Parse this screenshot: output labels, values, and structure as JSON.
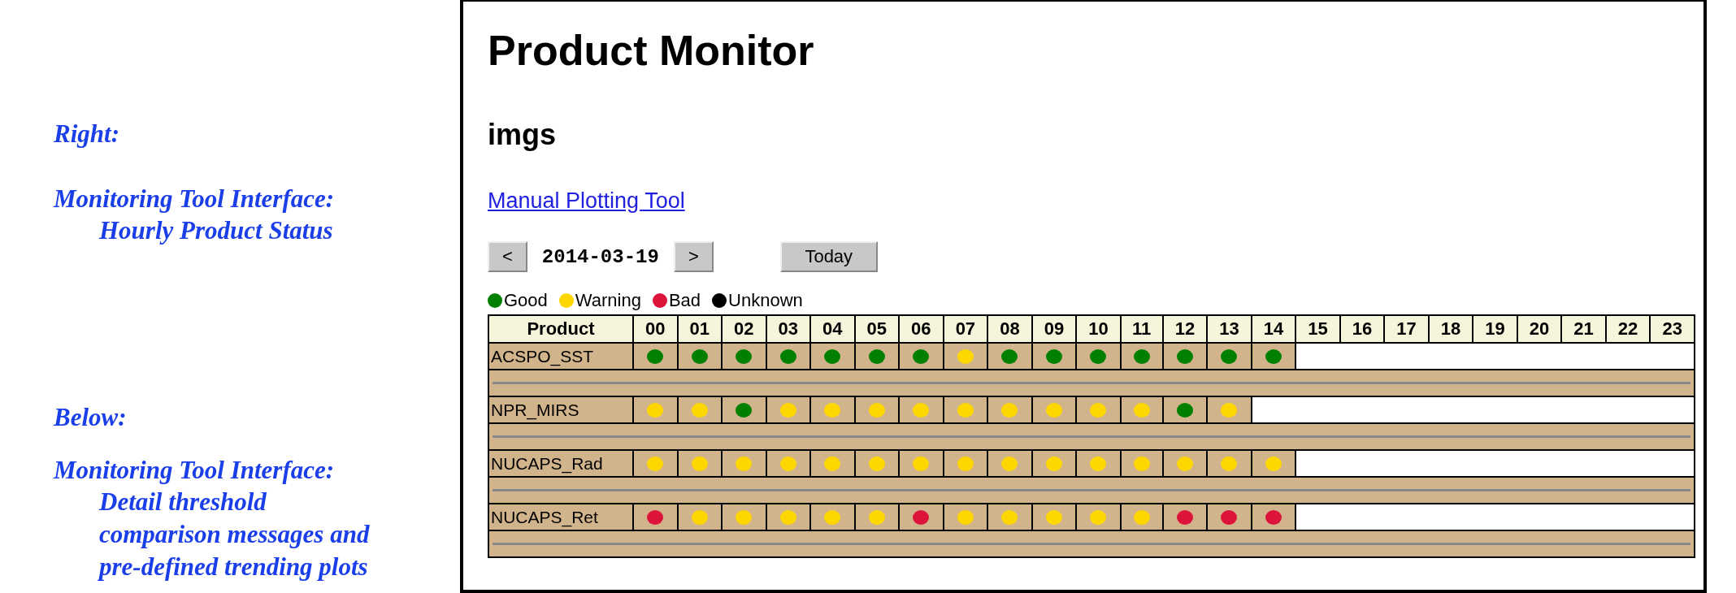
{
  "notes": [
    {
      "label": "Right:",
      "lines": [
        "Monitoring Tool Interface:",
        "Hourly Product Status"
      ]
    },
    {
      "label": "Below:",
      "lines": [
        "Monitoring Tool Interface:",
        "Detail threshold",
        "comparison messages and",
        "pre-defined trending plots"
      ]
    }
  ],
  "page": {
    "title": "Product Monitor",
    "subtitle": "imgs",
    "link": "Manual Plotting Tool"
  },
  "date_nav": {
    "prev": "<",
    "date": "2014-03-19",
    "next": ">",
    "today": "Today"
  },
  "legend": [
    {
      "label": "Good",
      "color": "#008000"
    },
    {
      "label": "Warning",
      "color": "#ffd700"
    },
    {
      "label": "Bad",
      "color": "#dc143c"
    },
    {
      "label": "Unknown",
      "color": "#000000"
    }
  ],
  "table": {
    "columns": [
      "Product",
      "00",
      "01",
      "02",
      "03",
      "04",
      "05",
      "06",
      "07",
      "08",
      "09",
      "10",
      "11",
      "12",
      "13",
      "14",
      "15",
      "16",
      "17",
      "18",
      "19",
      "20",
      "21",
      "22",
      "23"
    ],
    "rows": [
      {
        "product": "ACSPO_SST",
        "cells": [
          {
            "kind": "good"
          },
          {
            "kind": "good"
          },
          {
            "kind": "good"
          },
          {
            "kind": "good"
          },
          {
            "kind": "good"
          },
          {
            "kind": "good"
          },
          {
            "kind": "good"
          },
          {
            "kind": "warning"
          },
          {
            "kind": "good"
          },
          {
            "kind": "good"
          },
          {
            "kind": "good"
          },
          {
            "kind": "good"
          },
          {
            "kind": "good"
          },
          {
            "kind": "good"
          },
          {
            "kind": "good"
          }
        ]
      },
      {
        "product": "NPR_MIRS",
        "cells": [
          {
            "kind": "warning"
          },
          {
            "kind": "warning"
          },
          {
            "kind": "good"
          },
          {
            "kind": "warning"
          },
          {
            "kind": "warning"
          },
          {
            "kind": "warning"
          },
          {
            "kind": "warning"
          },
          {
            "kind": "warning"
          },
          {
            "kind": "warning"
          },
          {
            "kind": "warning"
          },
          {
            "kind": "warning"
          },
          {
            "kind": "warning"
          },
          {
            "kind": "good"
          },
          {
            "kind": "warning"
          }
        ]
      },
      {
        "product": "NUCAPS_Rad",
        "cells": [
          {
            "kind": "warning"
          },
          {
            "kind": "warning"
          },
          {
            "kind": "warning"
          },
          {
            "kind": "warning"
          },
          {
            "kind": "warning"
          },
          {
            "kind": "warning"
          },
          {
            "kind": "warning"
          },
          {
            "kind": "warning"
          },
          {
            "kind": "warning"
          },
          {
            "kind": "warning"
          },
          {
            "kind": "warning"
          },
          {
            "kind": "warning"
          },
          {
            "kind": "warning"
          },
          {
            "kind": "warning"
          },
          {
            "kind": "warning"
          }
        ]
      },
      {
        "product": "NUCAPS_Ret",
        "cells": [
          {
            "kind": "bad"
          },
          {
            "kind": "warning"
          },
          {
            "kind": "warning"
          },
          {
            "kind": "warning"
          },
          {
            "kind": "warning"
          },
          {
            "kind": "warning"
          },
          {
            "kind": "bad"
          },
          {
            "kind": "warning"
          },
          {
            "kind": "warning"
          },
          {
            "kind": "warning"
          },
          {
            "kind": "warning"
          },
          {
            "kind": "warning"
          },
          {
            "kind": "bad"
          },
          {
            "kind": "bad"
          },
          {
            "kind": "bad"
          }
        ]
      }
    ]
  }
}
